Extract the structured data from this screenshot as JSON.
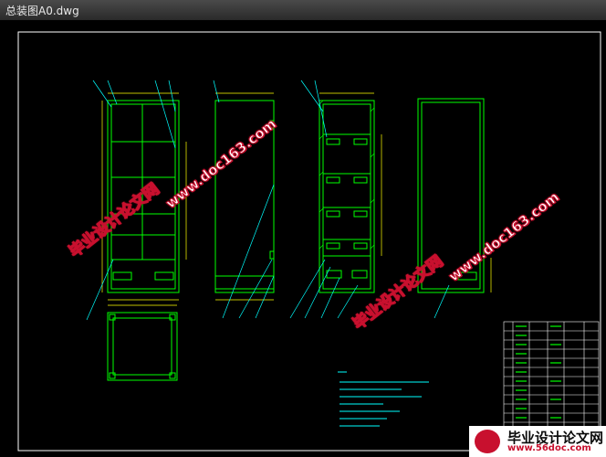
{
  "window": {
    "title": "总装图A0.dwg"
  },
  "watermarks": {
    "site_name": "毕业设计论文网",
    "site_url": "www.doc163.com"
  },
  "footer_logo": {
    "name": "毕业设计论文网",
    "url": "www.56doc.com"
  },
  "colors": {
    "background": "#000000",
    "frame_line": "#ffffff",
    "part_line": "#00ff00",
    "leader_line": "#00ffff",
    "dimension_line": "#ffff00",
    "watermark_fill": "#ffffff",
    "watermark_stroke": "#c8102e"
  }
}
